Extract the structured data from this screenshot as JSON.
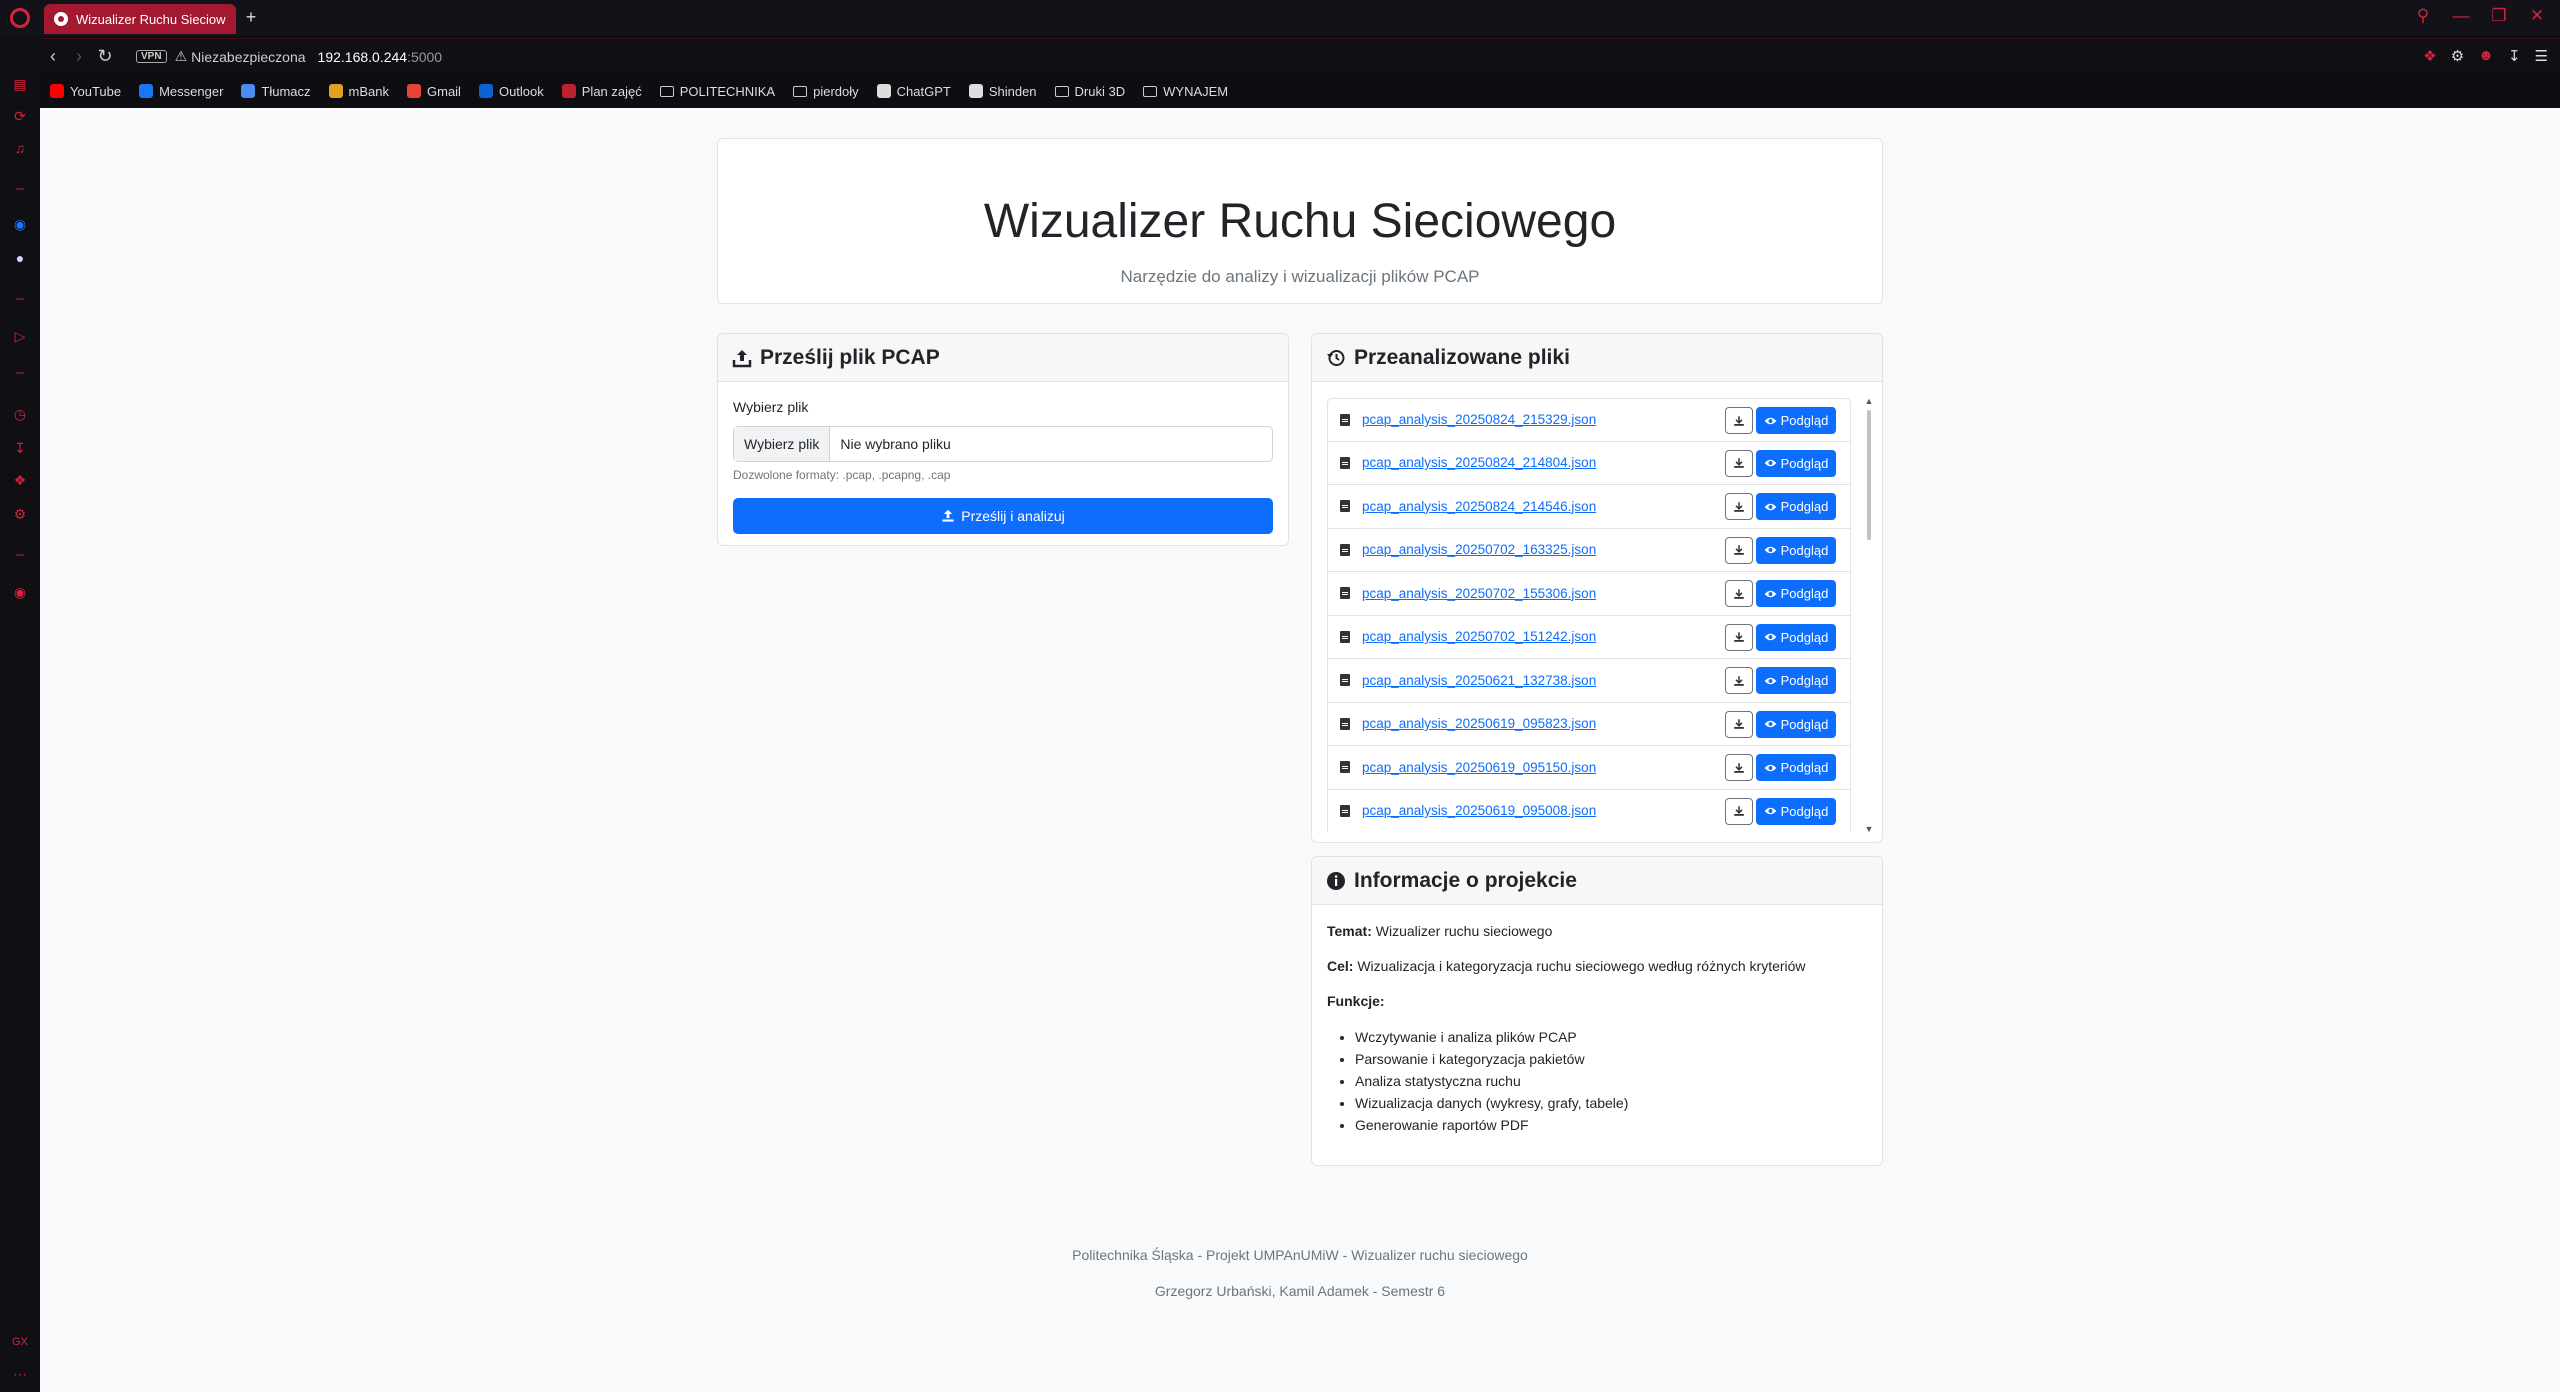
{
  "browser": {
    "tab_title": "Wizualizer Ruchu Sieciowego",
    "vpn_label": "VPN",
    "security_label": "Niezabezpieczona",
    "url_host": "192.168.0.244",
    "url_port": ":5000"
  },
  "bookmarks": [
    {
      "label": "YouTube",
      "icon": "youtube-icon",
      "color": "#ff0000"
    },
    {
      "label": "Messenger",
      "icon": "messenger-icon",
      "color": "#1877f2"
    },
    {
      "label": "Tłumacz",
      "icon": "translate-icon",
      "color": "#4a8af4"
    },
    {
      "label": "mBank",
      "icon": "mbank-icon",
      "color": "#e0a020"
    },
    {
      "label": "Gmail",
      "icon": "gmail-icon",
      "color": "#ea4335"
    },
    {
      "label": "Outlook",
      "icon": "outlook-icon",
      "color": "#0a64d6"
    },
    {
      "label": "Plan zajęć",
      "icon": "calendar-icon",
      "color": "#c02030"
    },
    {
      "label": "POLITECHNIKA",
      "icon": "folder-icon",
      "color": "#cccccc"
    },
    {
      "label": "pierdoły",
      "icon": "folder-icon",
      "color": "#cccccc"
    },
    {
      "label": "ChatGPT",
      "icon": "chatgpt-icon",
      "color": "#dddddd"
    },
    {
      "label": "Shinden",
      "icon": "shinden-icon",
      "color": "#dddddd"
    },
    {
      "label": "Druki 3D",
      "icon": "folder-icon",
      "color": "#cccccc"
    },
    {
      "label": "WYNAJEM",
      "icon": "folder-icon",
      "color": "#cccccc"
    }
  ],
  "header": {
    "title": "Wizualizer Ruchu Sieciowego",
    "subtitle": "Narzędzie do analizy i wizualizacji plików PCAP"
  },
  "upload": {
    "title": "Prześlij plik PCAP",
    "label": "Wybierz plik",
    "file_button": "Wybierz plik",
    "file_status": "Nie wybrano pliku",
    "help": "Dozwolone formaty: .pcap, .pcapng, .cap",
    "submit": "Prześlij i analizuj"
  },
  "analyzed": {
    "title": "Przeanalizowane pliki",
    "preview_label": "Podgląd",
    "files": [
      "pcap_analysis_20250824_215329.json",
      "pcap_analysis_20250824_214804.json",
      "pcap_analysis_20250824_214546.json",
      "pcap_analysis_20250702_163325.json",
      "pcap_analysis_20250702_155306.json",
      "pcap_analysis_20250702_151242.json",
      "pcap_analysis_20250621_132738.json",
      "pcap_analysis_20250619_095823.json",
      "pcap_analysis_20250619_095150.json",
      "pcap_analysis_20250619_095008.json"
    ]
  },
  "info": {
    "title": "Informacje o projekcie",
    "topic_label": "Temat:",
    "topic": "Wizualizer ruchu sieciowego",
    "goal_label": "Cel:",
    "goal": "Wizualizacja i kategoryzacja ruchu sieciowego według różnych kryteriów",
    "features_label": "Funkcje:",
    "features": [
      "Wczytywanie i analiza plików PCAP",
      "Parsowanie i kategoryzacja pakietów",
      "Analiza statystyczna ruchu",
      "Wizualizacja danych (wykresy, grafy, tabele)",
      "Generowanie raportów PDF"
    ]
  },
  "footer": {
    "line1": "Politechnika Śląska - Projekt UMPAnUMiW - Wizualizer ruchu sieciowego",
    "line2": "Grzegorz Urbański, Kamil Adamek - Semestr 6"
  },
  "colors": {
    "accent": "#d6223e",
    "primary": "#0d6efd"
  }
}
